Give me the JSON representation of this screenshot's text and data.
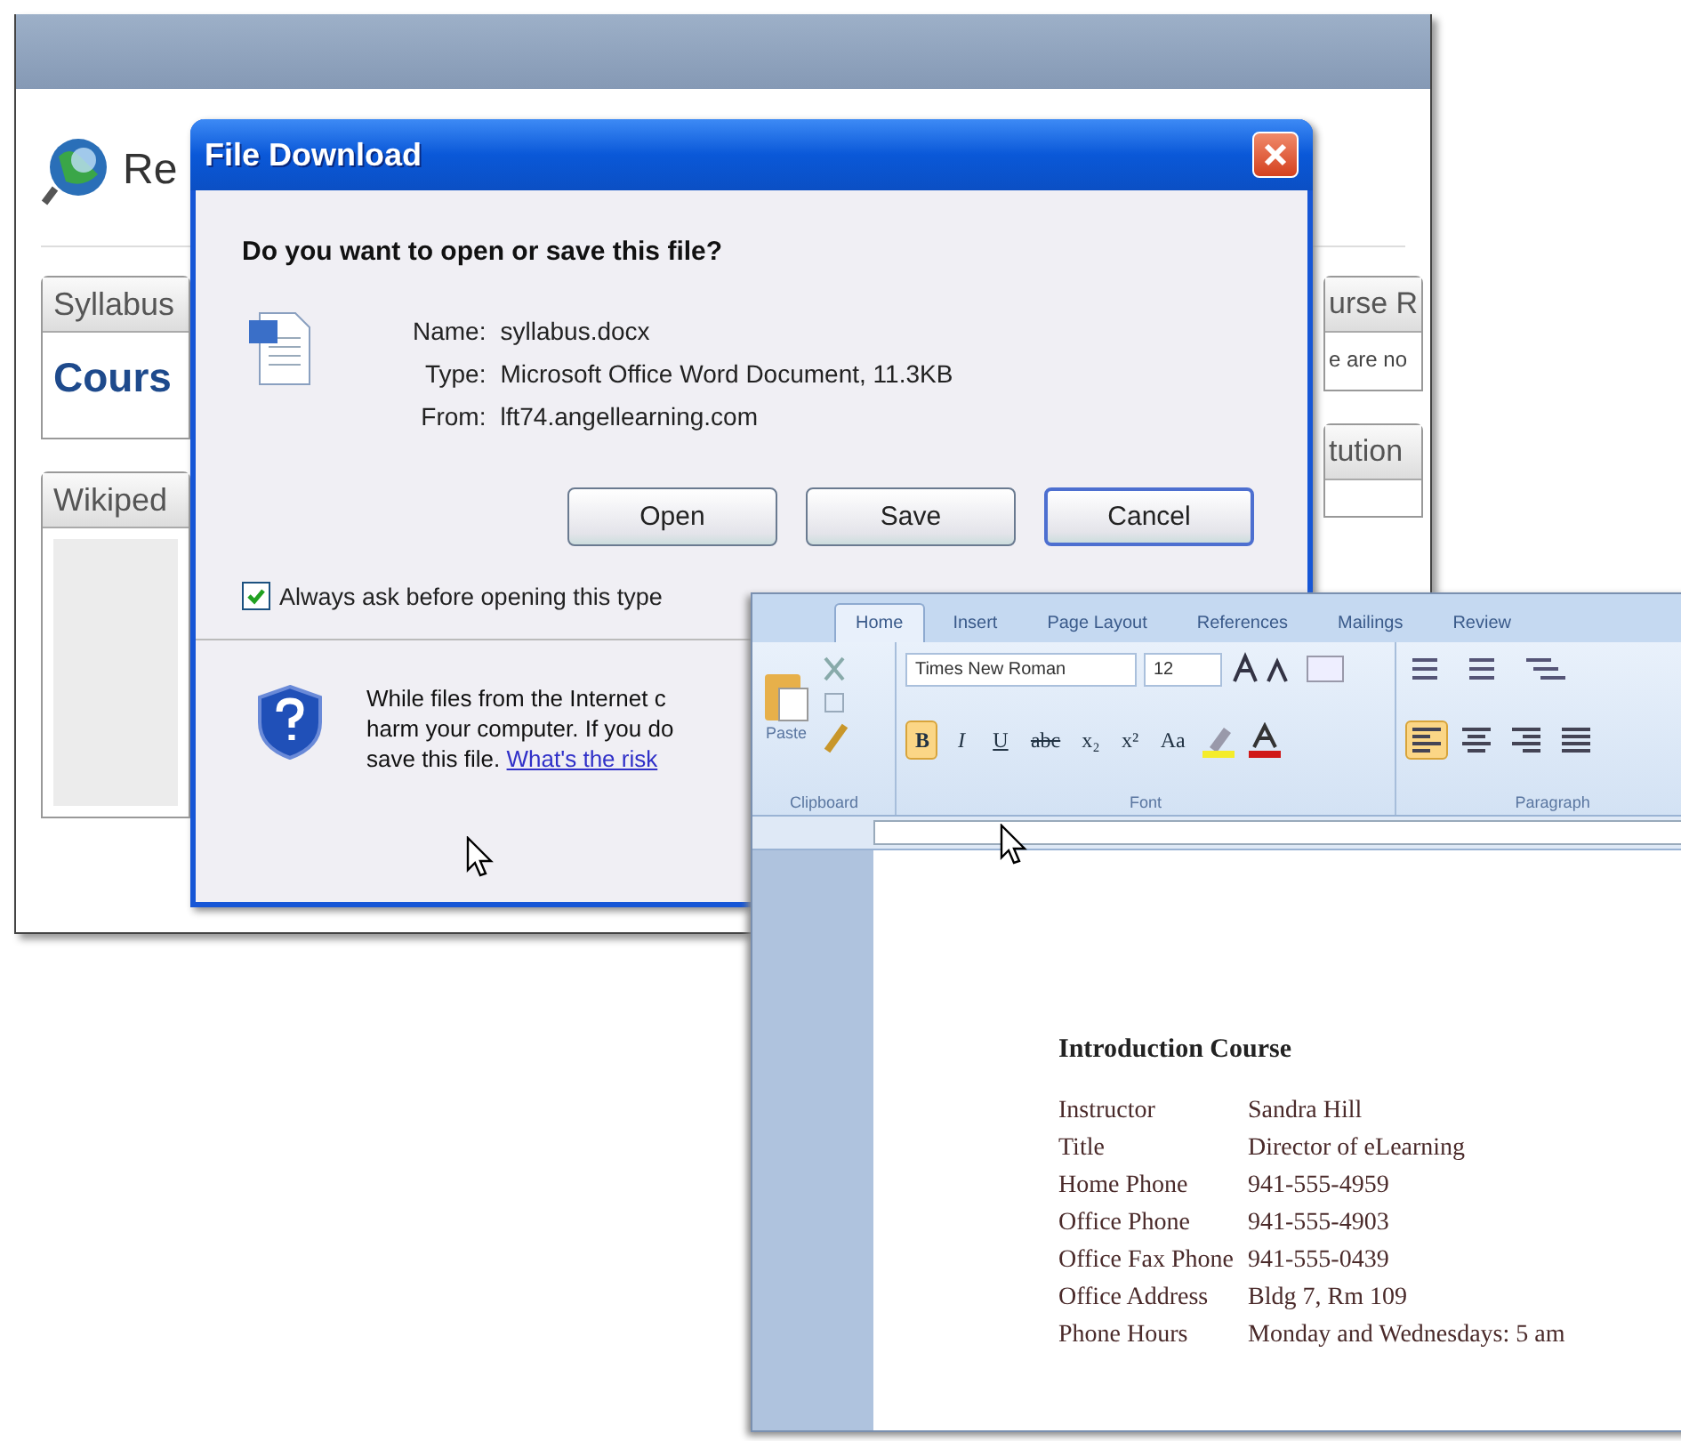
{
  "browser": {
    "page_title": "Re",
    "panels_left": [
      {
        "header": "Syllabus",
        "body": "Cours"
      },
      {
        "header": "Wikiped"
      }
    ],
    "panels_right": [
      {
        "header": "urse R",
        "body": "e are no"
      },
      {
        "header": "tution"
      }
    ]
  },
  "dialog": {
    "title": "File Download",
    "question": "Do you want to open or save this file?",
    "fields": [
      {
        "label": "Name:",
        "value": "syllabus.docx"
      },
      {
        "label": "Type:",
        "value": "Microsoft Office Word Document, 11.3KB"
      },
      {
        "label": "From:",
        "value": "lft74.angellearning.com"
      }
    ],
    "buttons": [
      {
        "label": "Open",
        "focused": false
      },
      {
        "label": "Save",
        "focused": false
      },
      {
        "label": "Cancel",
        "focused": true
      }
    ],
    "always_ask": {
      "label": "Always ask before opening this type",
      "checked": true
    },
    "warning": {
      "lines": [
        "While files from the Internet c",
        "harm your computer. If you do",
        "save this file."
      ],
      "link": "What's the risk"
    }
  },
  "word": {
    "tabs": [
      {
        "label": "Home",
        "selected": true
      },
      {
        "label": "Insert",
        "selected": false
      },
      {
        "label": "Page Layout",
        "selected": false
      },
      {
        "label": "References",
        "selected": false
      },
      {
        "label": "Mailings",
        "selected": false
      },
      {
        "label": "Review",
        "selected": false
      }
    ],
    "clipboard": {
      "paste": "Paste",
      "group": "Clipboard"
    },
    "font": {
      "name": "Times New Roman",
      "size": "12",
      "group": "Font",
      "buttons": [
        {
          "kind": "bold",
          "label": "B",
          "selected": true
        },
        {
          "kind": "italic",
          "label": "I",
          "selected": false
        },
        {
          "kind": "underline",
          "label": "U",
          "selected": false
        },
        {
          "kind": "strike",
          "label": "abc",
          "selected": false
        },
        {
          "kind": "sub",
          "label": "x₂",
          "selected": false
        },
        {
          "kind": "sup",
          "label": "x²",
          "selected": false
        },
        {
          "kind": "case",
          "label": "Aa",
          "selected": false
        }
      ]
    },
    "paragraph": {
      "group": "Paragraph",
      "alignments": [
        {
          "kind": "left",
          "selected": true
        },
        {
          "kind": "center",
          "selected": false
        },
        {
          "kind": "right",
          "selected": false
        },
        {
          "kind": "justify",
          "selected": false
        }
      ]
    },
    "document": {
      "heading": "Introduction Course",
      "rows": [
        {
          "label": "Instructor",
          "value": "Sandra Hill"
        },
        {
          "label": "Title",
          "value": "Director of eLearning"
        },
        {
          "label": "Home Phone",
          "value": "941-555-4959"
        },
        {
          "label": "Office Phone",
          "value": "941-555-4903"
        },
        {
          "label": "Office Fax Phone",
          "value": "941-555-0439"
        },
        {
          "label": "Office Address",
          "value": "Bldg 7, Rm 109"
        },
        {
          "label": "Phone Hours",
          "value": "Monday and Wednesdays: 5 am"
        }
      ]
    }
  }
}
